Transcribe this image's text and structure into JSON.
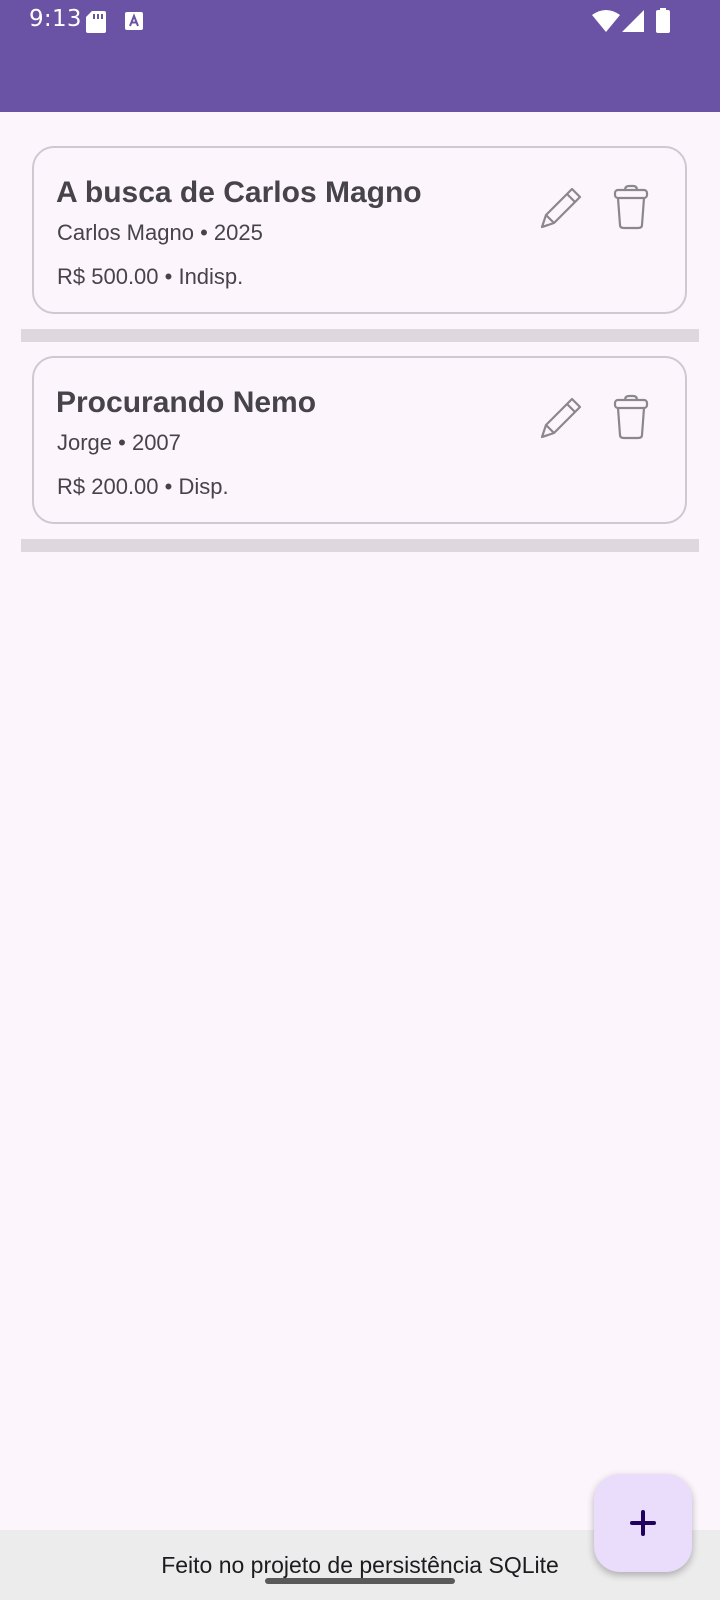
{
  "status_bar": {
    "time": "9:13",
    "icons": [
      "sd-card-icon",
      "a-icon",
      "wifi-icon",
      "signal-icon",
      "battery-icon"
    ]
  },
  "colors": {
    "app_bar": "#6a52a4",
    "background": "#fcf6fc",
    "fab": "#eaddfb"
  },
  "movies": [
    {
      "title": "A busca de Carlos Magno",
      "subtitle": "Carlos Magno • 2025",
      "price_line": "R$ 500.00 • Indisp.",
      "actions": [
        "pencil-icon",
        "trash-icon"
      ]
    },
    {
      "title": "Procurando Nemo",
      "subtitle": "Jorge • 2007",
      "price_line": "R$ 200.00 • Disp.",
      "actions": [
        "pencil-icon",
        "trash-icon"
      ]
    }
  ],
  "fab": {
    "icon": "plus-icon"
  },
  "footer": {
    "text": "Feito no projeto de persistência SQLite"
  }
}
